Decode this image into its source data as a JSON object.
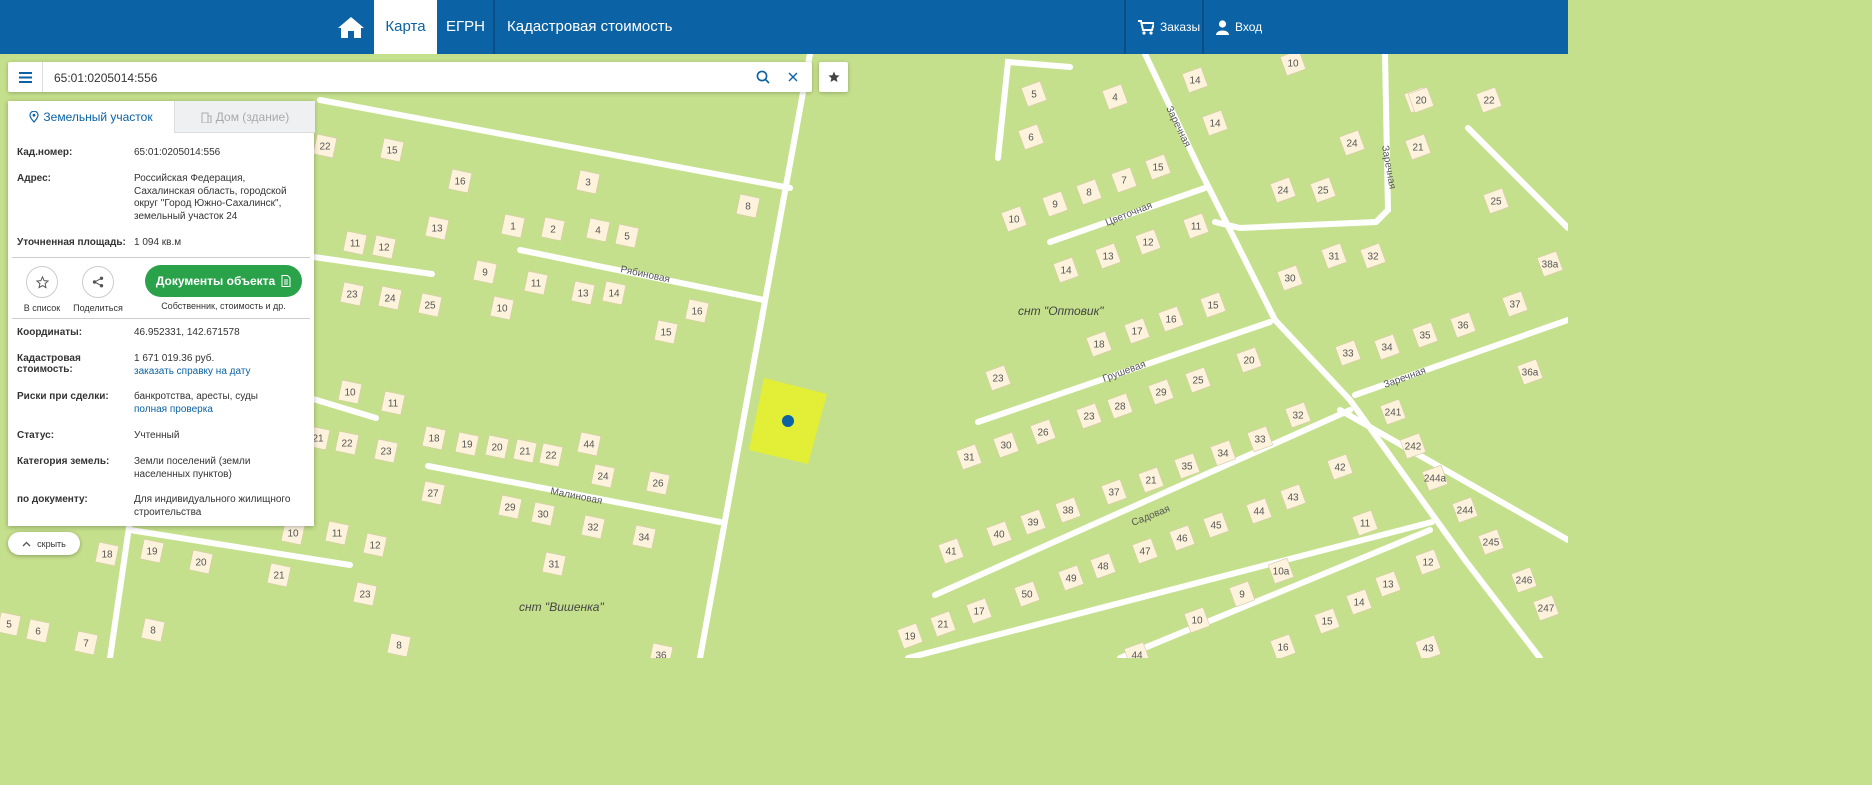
{
  "topbar": {
    "tabs": [
      "Карта",
      "ЕГРН",
      "Кадастровая стоимость"
    ],
    "orders_label": "Заказы",
    "login_label": "Вход",
    "bg_color": "#0b62a4"
  },
  "search": {
    "value": "65:01:0205014:556"
  },
  "panel": {
    "tab_land": "Земельный участок",
    "tab_house": "Дом (здание)",
    "fields": {
      "cad_label": "Кад.номер:",
      "cad_value": "65:01:0205014:556",
      "addr_label": "Адрес:",
      "addr_value": "Российская Федерация, Сахалинская область, городской округ \"Город Южно-Сахалинск\", земельный участок 24",
      "area_label": "Уточненная площадь:",
      "area_value": "1 094 кв.м",
      "coords_label": "Координаты:",
      "coords_value": "46.952331, 142.671578",
      "cost_label": "Кадастровая стоимость:",
      "cost_value": "1 671 019.36 руб.",
      "cost_link": "заказать справку на дату",
      "risk_label": "Риски при сделки:",
      "risk_value": "банкротства, аресты, суды",
      "risk_link": "полная проверка",
      "status_label": "Статус:",
      "status_value": "Учтенный",
      "category_label": "Категория земель:",
      "category_value": "Земли поселений (земли населенных пунктов)",
      "doc_label": "по документу:",
      "doc_value": "Для индивидуального жилищного строительства"
    },
    "actions": {
      "to_list": "В список",
      "share": "Поделиться",
      "docs_button": "Документы объекта",
      "docs_sub": "Собственник, стоимость и др."
    },
    "hide_label": "скрыть",
    "accent_green": "#2aa24a"
  },
  "map": {
    "snt_labels": [
      "снт \"Оптовик\"",
      "снт \"Вишенка\""
    ],
    "streets": [
      "Рябиновая",
      "Малиновая",
      "Цветочная",
      "Грушевая",
      "Садовая",
      "Заречная"
    ],
    "houses": [
      "14",
      "15",
      "16",
      "3",
      "8",
      "13",
      "1",
      "2",
      "4",
      "5",
      "11",
      "12",
      "9",
      "11",
      "13",
      "14",
      "10",
      "23",
      "24",
      "25",
      "15",
      "16",
      "10",
      "11",
      "18",
      "19",
      "20",
      "21",
      "22",
      "23",
      "24",
      "26",
      "27",
      "29",
      "30",
      "32",
      "34",
      "31",
      "21",
      "22",
      "23",
      "10",
      "11",
      "12",
      "20",
      "21",
      "23",
      "18",
      "19",
      "5",
      "6",
      "7",
      "8",
      "5",
      "4",
      "14",
      "10",
      "6",
      "14",
      "15",
      "7",
      "8",
      "9",
      "10",
      "11",
      "12",
      "13",
      "14",
      "15",
      "16",
      "17",
      "18",
      "19",
      "20",
      "21",
      "22",
      "23",
      "24",
      "25",
      "26",
      "27",
      "28",
      "29",
      "30",
      "31",
      "32",
      "33",
      "34",
      "35",
      "36",
      "37",
      "38",
      "39",
      "40",
      "41",
      "42",
      "43",
      "44",
      "45",
      "46",
      "47",
      "48",
      "49",
      "50",
      "17",
      "21",
      "19",
      "22",
      "20",
      "24",
      "25",
      "30",
      "31",
      "32",
      "33",
      "34",
      "35",
      "36",
      "37",
      "38а",
      "36а",
      "241",
      "242",
      "244а",
      "244",
      "245",
      "246",
      "247",
      "11",
      "12",
      "13",
      "14",
      "15",
      "10а",
      "9",
      "10",
      "16",
      "43",
      "44",
      "8",
      "36",
      "44",
      "23",
      "25",
      "20",
      "21",
      "22"
    ]
  }
}
